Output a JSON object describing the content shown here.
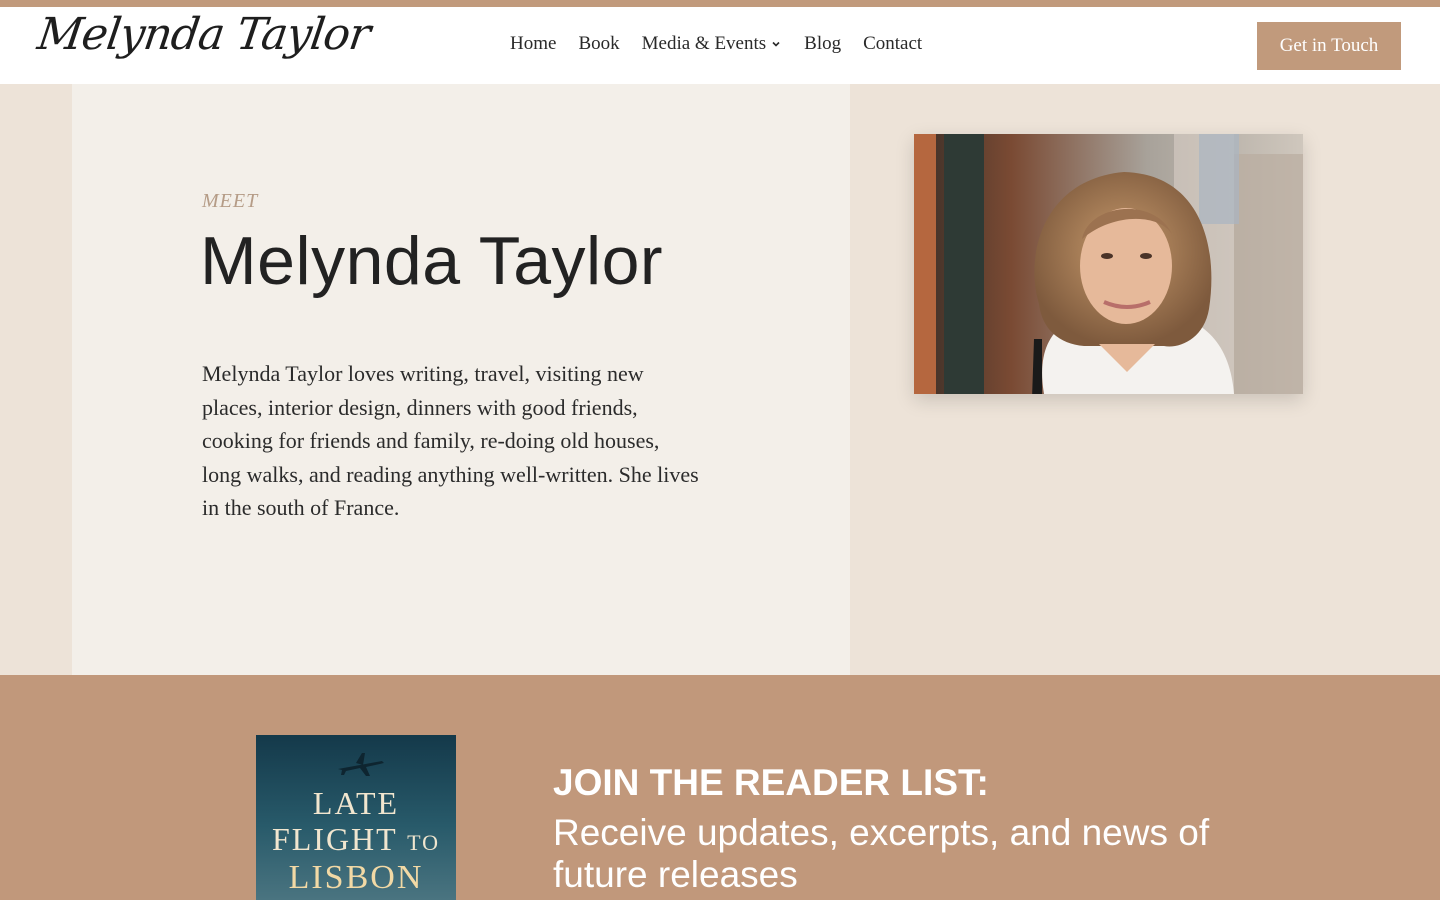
{
  "header": {
    "logo_text": "Melynda Taylor",
    "nav": [
      {
        "label": "Home"
      },
      {
        "label": "Book"
      },
      {
        "label": "Media & Events",
        "has_dropdown": true
      },
      {
        "label": "Blog"
      },
      {
        "label": "Contact"
      }
    ],
    "cta_label": "Get in Touch"
  },
  "hero": {
    "eyebrow": "MEET",
    "title": "Melynda Taylor",
    "bio": "Melynda Taylor loves writing, travel, visiting new places, interior design, dinners with good friends, cooking for friends and family, re-doing old houses, long walks, and reading anything well-written. She lives in the south of France.",
    "portrait_alt": "portrait-photo"
  },
  "reader_list": {
    "book_cover": {
      "line1": "LATE",
      "line2_main": "FLIGHT",
      "line2_small": "TO",
      "line3": "LISBON",
      "icon": "airplane-icon"
    },
    "title": "JOIN THE READER LIST:",
    "subtitle": "Receive updates, excerpts, and news of future releases"
  },
  "colors": {
    "accent": "#c19a7c",
    "hero_panel": "#f3efe9",
    "page_bg": "#ede3d8",
    "band_bg": "#c1987b"
  }
}
